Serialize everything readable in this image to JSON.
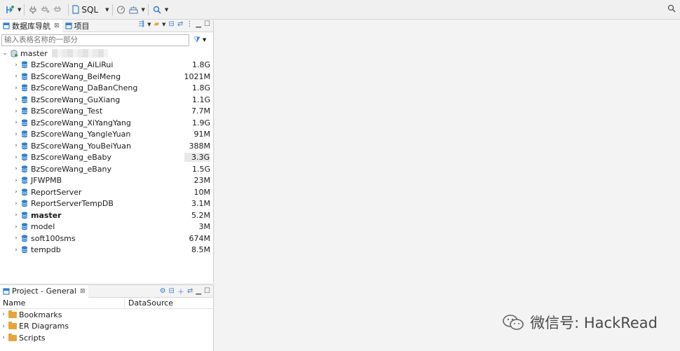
{
  "toolbar": {
    "sql_label": "SQL"
  },
  "nav": {
    "tab_db": "数据库导航",
    "tab_project": "项目",
    "filter_placeholder": "输入表格名称的一部分",
    "root_label": "master",
    "databases": [
      {
        "name": "BzScoreWang_AiLiRui",
        "size": "1.8G",
        "bold": false
      },
      {
        "name": "BzScoreWang_BeiMeng",
        "size": "1021M",
        "bold": false
      },
      {
        "name": "BzScoreWang_DaBanCheng",
        "size": "1.8G",
        "bold": false
      },
      {
        "name": "BzScoreWang_GuXiang",
        "size": "1.1G",
        "bold": false
      },
      {
        "name": "BzScoreWang_Test",
        "size": "7.7M",
        "bold": false
      },
      {
        "name": "BzScoreWang_XiYangYang",
        "size": "1.9G",
        "bold": false
      },
      {
        "name": "BzScoreWang_YangleYuan",
        "size": "91M",
        "bold": false
      },
      {
        "name": "BzScoreWang_YouBeiYuan",
        "size": "388M",
        "bold": false
      },
      {
        "name": "BzScoreWang_eBaby",
        "size": "3.3G",
        "bold": false,
        "highlight": true
      },
      {
        "name": "BzScoreWang_eBany",
        "size": "1.5G",
        "bold": false
      },
      {
        "name": "JFWPMB",
        "size": "23M",
        "bold": false
      },
      {
        "name": "ReportServer",
        "size": "10M",
        "bold": false
      },
      {
        "name": "ReportServerTempDB",
        "size": "3.1M",
        "bold": false
      },
      {
        "name": "master",
        "size": "5.2M",
        "bold": true
      },
      {
        "name": "model",
        "size": "3M",
        "bold": false
      },
      {
        "name": "soft100sms",
        "size": "674M",
        "bold": false
      },
      {
        "name": "tempdb",
        "size": "8.5M",
        "bold": false
      }
    ]
  },
  "project": {
    "title": "Project - General",
    "col_name": "Name",
    "col_datasource": "DataSource",
    "items": [
      {
        "label": "Bookmarks"
      },
      {
        "label": "ER Diagrams"
      },
      {
        "label": "Scripts"
      }
    ]
  },
  "watermark": {
    "text": "微信号: HackRead"
  },
  "colors": {
    "db_icon": "#2f7fd0",
    "accent": "#3a7bd5",
    "folder": "#e8a43a"
  }
}
